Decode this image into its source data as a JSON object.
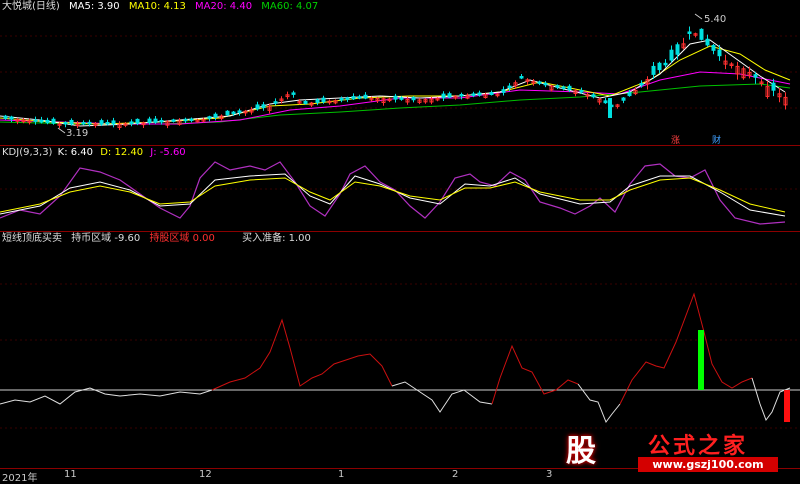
{
  "main_panel": {
    "title": "大悦城(日线)",
    "ma5": "MA5: 3.90",
    "ma10": "MA10: 4.13",
    "ma20": "MA20: 4.40",
    "ma60": "MA60: 4.07",
    "high_label": "5.40",
    "low_label": "3.19",
    "badge_zhang": "涨",
    "badge_cai": "财",
    "colors": {
      "ma5": "#ffffff",
      "ma10": "#ffff00",
      "ma20": "#ff00ff",
      "ma60": "#00c000",
      "up": "#ff3030",
      "down": "#00e0e0"
    }
  },
  "kdj_panel": {
    "title": "KDJ(9,3,3)",
    "k": "K: 6.40",
    "d": "D: 12.40",
    "j": "J: -5.60"
  },
  "indicator_panel": {
    "title": "短线顶底买卖",
    "holding": "持币区域 -9.60",
    "stock_zone": "持股区域 0.00",
    "buy_ready": "买入准备: 1.00"
  },
  "x_axis": {
    "ticks": [
      "2021年",
      "11",
      "12",
      "1",
      "2",
      "3"
    ]
  },
  "watermark": {
    "icon_text": "股",
    "title": "公式之家",
    "url": "www.gszj100.com"
  }
}
